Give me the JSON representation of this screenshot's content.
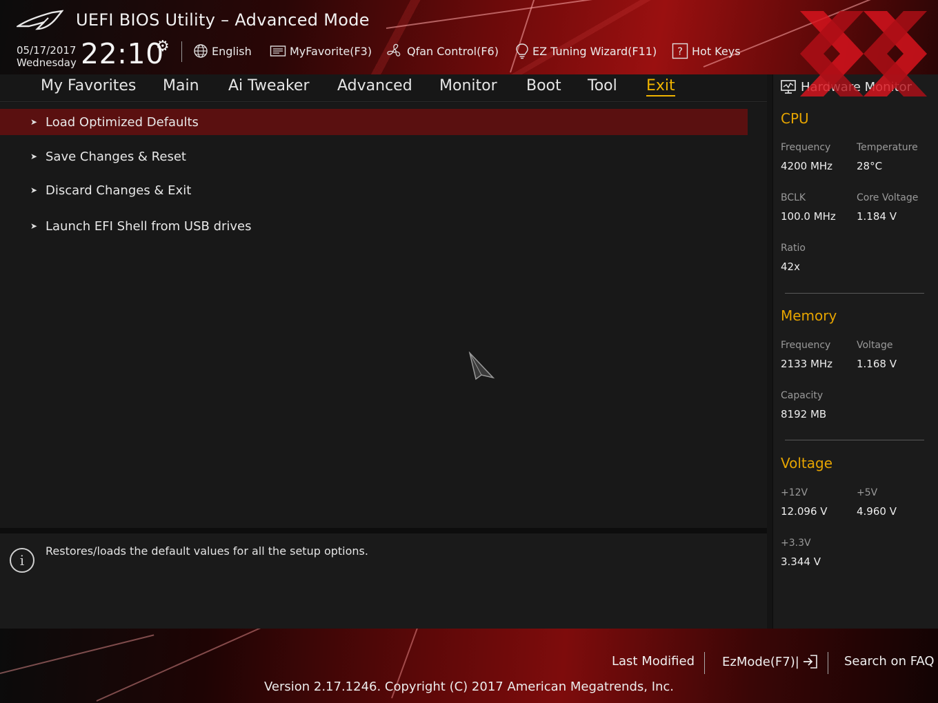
{
  "header": {
    "title": "UEFI BIOS Utility – Advanced Mode",
    "date": "05/17/2017",
    "weekday": "Wednesday",
    "time": "22:10",
    "buttons": {
      "language": "English",
      "favorite": "MyFavorite(F3)",
      "qfan": "Qfan Control(F6)",
      "ez_tuning": "EZ Tuning Wizard(F11)",
      "hot_keys": "Hot Keys"
    }
  },
  "tabs": [
    {
      "label": "My Favorites"
    },
    {
      "label": "Main"
    },
    {
      "label": "Ai Tweaker"
    },
    {
      "label": "Advanced"
    },
    {
      "label": "Monitor"
    },
    {
      "label": "Boot"
    },
    {
      "label": "Tool"
    },
    {
      "label": "Exit",
      "active": true
    }
  ],
  "menu": [
    {
      "label": "Load Optimized Defaults",
      "selected": true
    },
    {
      "label": "Save Changes & Reset"
    },
    {
      "label": "Discard Changes & Exit"
    },
    {
      "label": "Launch EFI Shell from USB drives"
    }
  ],
  "help": {
    "text": "Restores/loads the default values for all the setup options."
  },
  "hardware_monitor": {
    "title": "Hardware Monitor",
    "cpu": {
      "heading": "CPU",
      "frequency_label": "Frequency",
      "frequency": "4200 MHz",
      "temperature_label": "Temperature",
      "temperature": "28°C",
      "bclk_label": "BCLK",
      "bclk": "100.0 MHz",
      "core_voltage_label": "Core Voltage",
      "core_voltage": "1.184 V",
      "ratio_label": "Ratio",
      "ratio": "42x"
    },
    "memory": {
      "heading": "Memory",
      "frequency_label": "Frequency",
      "frequency": "2133 MHz",
      "voltage_label": "Voltage",
      "voltage": "1.168 V",
      "capacity_label": "Capacity",
      "capacity": "8192 MB"
    },
    "voltage": {
      "heading": "Voltage",
      "v12_label": "+12V",
      "v12": "12.096 V",
      "v5_label": "+5V",
      "v5": "4.960 V",
      "v33_label": "+3.3V",
      "v33": "3.344 V"
    }
  },
  "footer": {
    "last_modified": "Last Modified",
    "ez_mode": "EzMode(F7)|",
    "search_faq": "Search on FAQ",
    "version": "Version 2.17.1246. Copyright (C) 2017 American Megatrends, Inc."
  },
  "colors": {
    "accent": "#f0b400",
    "section_heading": "#e6a400",
    "selected_row": "#5a1010",
    "brand_red": "#9a1010"
  }
}
